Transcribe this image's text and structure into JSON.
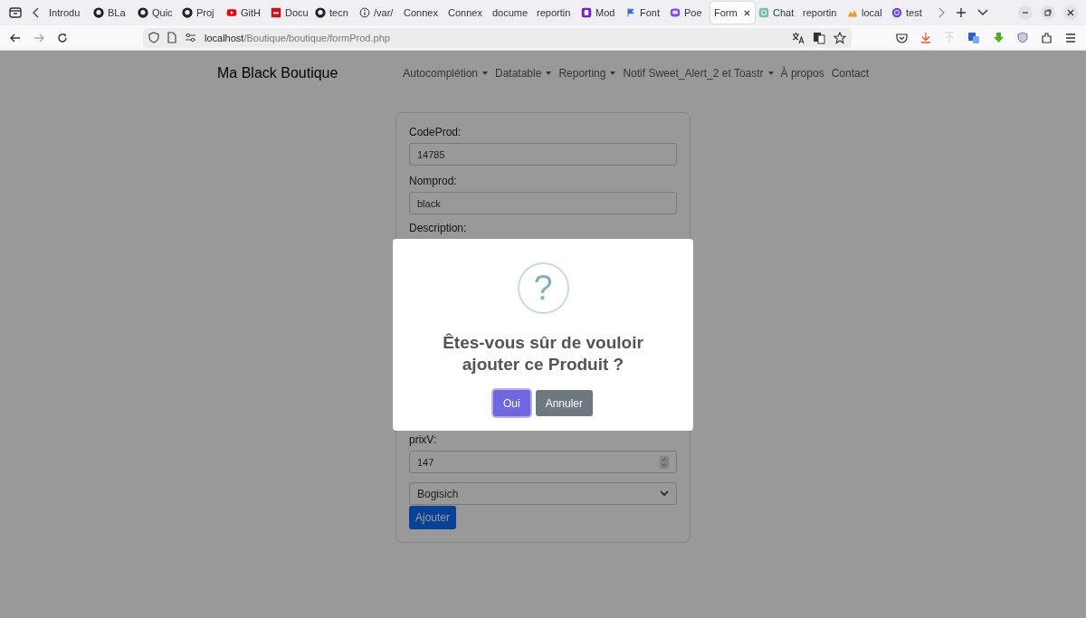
{
  "browser": {
    "tabs": [
      {
        "title": "Introdu",
        "kind": "plain",
        "selected": false
      },
      {
        "title": "BLa",
        "kind": "github",
        "selected": false
      },
      {
        "title": "Quic",
        "kind": "github",
        "selected": false
      },
      {
        "title": "Proj",
        "kind": "github",
        "selected": false
      },
      {
        "title": "GitH",
        "kind": "youtube",
        "selected": false
      },
      {
        "title": "Docu",
        "kind": "pdf",
        "selected": false
      },
      {
        "title": "tecn",
        "kind": "github",
        "selected": false
      },
      {
        "title": "/var/",
        "kind": "info",
        "selected": false
      },
      {
        "title": "Connex",
        "kind": "plain",
        "selected": false
      },
      {
        "title": "Connex",
        "kind": "plain",
        "selected": false
      },
      {
        "title": "docume",
        "kind": "plain",
        "selected": false
      },
      {
        "title": "reportin",
        "kind": "plain",
        "selected": false
      },
      {
        "title": "Mod",
        "kind": "bootstrap",
        "selected": false
      },
      {
        "title": "Font",
        "kind": "flag",
        "selected": false
      },
      {
        "title": "Poe",
        "kind": "poe",
        "selected": false
      },
      {
        "title": "Form",
        "kind": "plain",
        "selected": true
      },
      {
        "title": "Chat",
        "kind": "chat",
        "selected": false
      },
      {
        "title": "reportin",
        "kind": "plain",
        "selected": false
      },
      {
        "title": "local",
        "kind": "fire",
        "selected": false
      },
      {
        "title": "test",
        "kind": "letter",
        "selected": false
      }
    ],
    "url_host": "localhost",
    "url_path": "/Boutique/boutique/formProd.php"
  },
  "navbar": {
    "brand": "Ma Black Boutique",
    "items": [
      {
        "label": "Autocomplétion",
        "dropdown": true
      },
      {
        "label": "Datatable",
        "dropdown": true
      },
      {
        "label": "Reporting",
        "dropdown": true
      },
      {
        "label": "Notif Sweet_Alert_2 et Toastr",
        "dropdown": true
      },
      {
        "label": "À propos",
        "dropdown": false
      },
      {
        "label": "Contact",
        "dropdown": false
      }
    ]
  },
  "form": {
    "fields_top": [
      {
        "label": "CodeProd:",
        "value": "14785"
      },
      {
        "label": "Nomprod:",
        "value": "black"
      }
    ],
    "partial_label": "Description:",
    "price": {
      "label": "prixV:",
      "value": "147"
    },
    "select": {
      "value": "Bogisich"
    },
    "submit": "Ajouter"
  },
  "dialog": {
    "icon": "?",
    "title": "Êtes-vous sûr de vouloir ajouter ce Produit ?",
    "confirm": "Oui",
    "cancel": "Annuler"
  }
}
